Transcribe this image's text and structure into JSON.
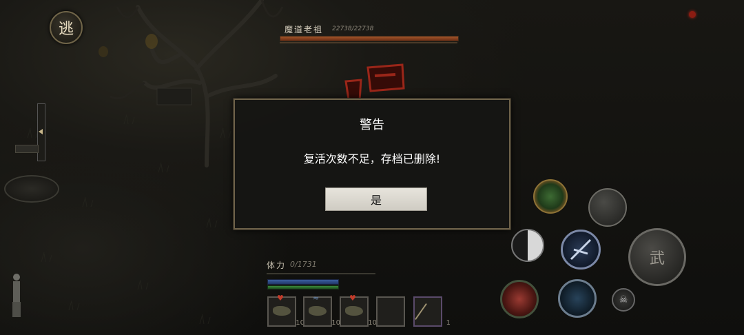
{
  "hud": {
    "flee_button": "逃",
    "boss": {
      "name": "魔道老祖",
      "hp_text": "22738/22738",
      "hp_fraction": 1.0
    },
    "stamina": {
      "label": "体力",
      "value": "0/1731"
    },
    "inventory": [
      {
        "icon": "herb-icon",
        "count": "10",
        "badge": "heart"
      },
      {
        "icon": "herb-icon",
        "count": "10",
        "badge": "wing"
      },
      {
        "icon": "herb-icon",
        "count": "10",
        "badge": "heart"
      },
      {
        "icon": "empty-slot",
        "count": ""
      },
      {
        "icon": "stick-icon",
        "count": "1"
      }
    ],
    "skills": [
      "jade-orb-skill-icon",
      "gray-skill-icon",
      "taiji-skill-icon",
      "blade-skill-icon",
      "martial-arts-skill-icon",
      "red-flower-skill-icon",
      "shadow-skill-icon",
      "skull-skill-icon"
    ],
    "big_skill_label": "武"
  },
  "dialog": {
    "title": "警告",
    "message": "复活次数不足，存档已删除!",
    "confirm_label": "是"
  },
  "colors": {
    "dialog_border": "#6e624a",
    "boss_bar": "#a5552a",
    "mana_bar": "#3b5fa0",
    "stamina_bar": "#3a8a3a"
  }
}
